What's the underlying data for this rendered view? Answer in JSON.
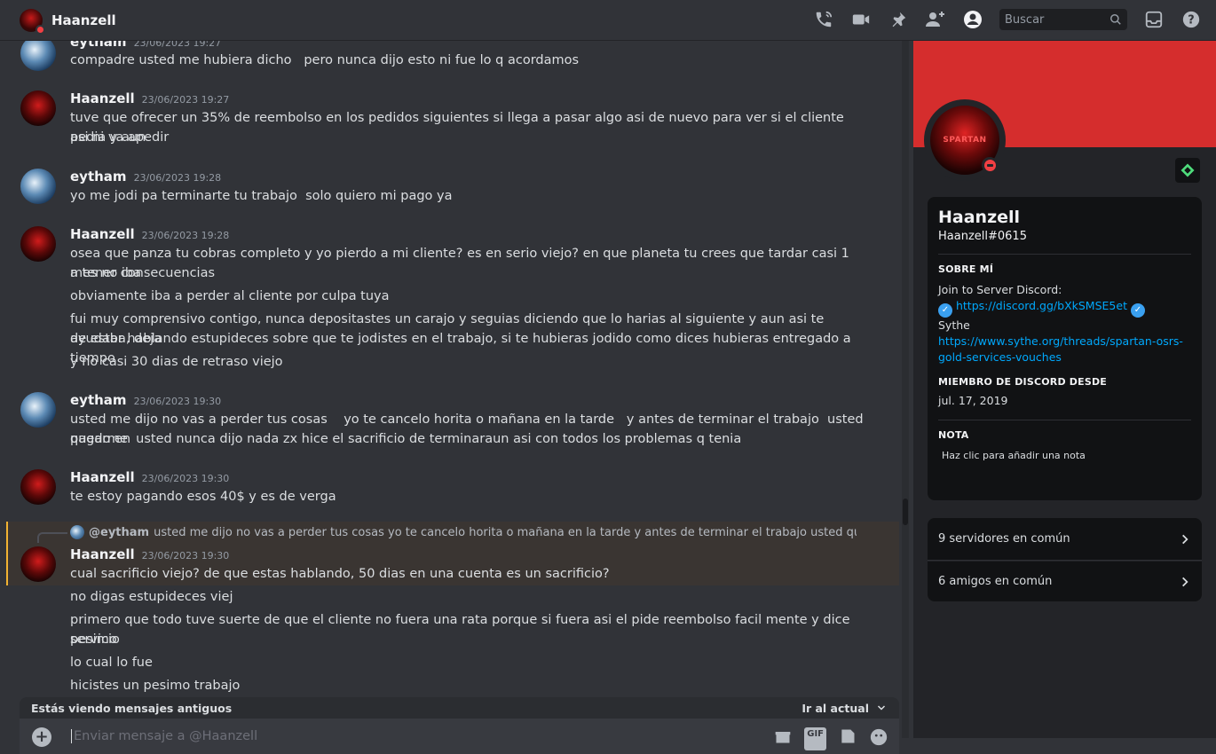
{
  "header": {
    "title": "Haanzell",
    "search_placeholder": "Buscar",
    "icons": [
      "call-icon",
      "video-icon",
      "pin-icon",
      "add-member-icon",
      "profile-toggle-icon",
      "search-icon",
      "inbox-icon",
      "help-icon"
    ]
  },
  "messages": [
    {
      "author": "eytham",
      "time": "23/06/2023 19:27",
      "lines": [
        "compadre usted me hubiera dicho   pero nunca dijo esto ni fue lo q acordamos"
      ]
    },
    {
      "author": "Haanzell",
      "time": "23/06/2023 19:27",
      "lines": [
        "tuve que ofrecer un 35% de reembolso en los pedidos siguientes si llega a pasar algo asi de nuevo para ver si el cliente pedia y aun",
        "asi ni va apedir"
      ]
    },
    {
      "author": "eytham",
      "time": "23/06/2023 19:28",
      "lines": [
        "yo me jodi pa terminarte tu trabajo  solo quiero mi pago ya"
      ]
    },
    {
      "author": "Haanzell",
      "time": "23/06/2023 19:28",
      "lines": [
        "osea que panza tu cobras completo y yo pierdo a mi cliente? es en serio viejo? en que planeta tu crees que tardar casi 1 mes no iba",
        "a tener consecuencias",
        "obviamente iba a perder al cliente por culpa tuya",
        "fui muy comprensivo contigo, nunca depositastes un carajo y seguias diciendo que lo harias al siguiente y aun asi te ayudaba, deja",
        "de estar hablando estupideces sobre que te jodistes en el trabajo, si te hubieras jodido como dices hubieras entregado a tiempo",
        "y no casi 30 dias de retraso viejo"
      ]
    },
    {
      "author": "eytham",
      "time": "23/06/2023 19:30",
      "lines": [
        "usted me dijo no vas a perder tus cosas    yo te cancelo horita o mañana en la tarde   y antes de terminar el trabajo  usted quedo en",
        "pagarme  usted nunca dijo nada zx hice el sacrificio de terminaraun asi con todos los problemas q tenia"
      ]
    },
    {
      "author": "Haanzell",
      "time": "23/06/2023 19:30",
      "lines": [
        "te estoy pagando esos 40$ y es de verga"
      ]
    },
    {
      "author": "Haanzell",
      "time": "23/06/2023 19:30",
      "reply_to": "@eytham",
      "reply_text": "usted me dijo no vas a perder tus cosas yo te cancelo horita o mañana en la tarde y antes de terminar el trabajo usted quedo en pagarme",
      "lines": [
        "cual sacrificio viejo? de que estas hablando, 50 dias en una cuenta es un sacrificio?",
        "no digas estupideces viej",
        "primero que todo tuve suerte de que el cliente no fuera una rata porque si fuera asi el pide reembolso facil mente y dice pesimo",
        "servicio",
        "lo cual lo fue",
        "hicistes un pesimo trabajo"
      ]
    }
  ],
  "old_messages_bar": {
    "text": "Estás viendo mensajes antiguos",
    "jump": "Ir al actual"
  },
  "composer": {
    "placeholder": "Enviar mensaje a @Haanzell",
    "tools": [
      "gift-icon",
      "GIF",
      "sticker-icon",
      "emoji-icon"
    ]
  },
  "profile": {
    "name": "Haanzell",
    "tag": "Haanzell#0615",
    "avatar_text": "SPARTAN",
    "about_heading": "SOBRE MÍ",
    "about_line1": "Join to Server Discord:",
    "discord_link": "https://discord.gg/bXkSMSE5et",
    "about_line2": "Sythe",
    "sythe_link_1": "https://www.sythe.org/threads/spartan-osrs-",
    "sythe_link_2": "gold-services-vouches",
    "member_heading": "MIEMBRO DE DISCORD DESDE",
    "member_since": "jul. 17, 2019",
    "note_heading": "NOTA",
    "note_placeholder": "Haz clic para añadir una nota",
    "mutual_servers": "9 servidores en común",
    "mutual_friends": "6 amigos en común"
  },
  "colors": {
    "banner": "#d52d2d",
    "dnd": "#f23f43",
    "link": "#00a8fc",
    "highlight_border": "#f0b232"
  }
}
